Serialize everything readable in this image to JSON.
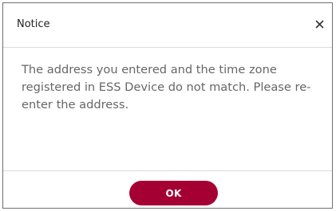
{
  "dialog": {
    "title": "Notice",
    "close_icon": "close-icon",
    "message": "The address you entered and the time zone registered in ESS Device do not match. Please re-enter the address.",
    "ok_label": "OK"
  },
  "colors": {
    "accent": "#a50034",
    "title_text": "#222222",
    "message_text": "#666666",
    "divider": "#dcdcdc",
    "border": "#6f6f6f"
  }
}
